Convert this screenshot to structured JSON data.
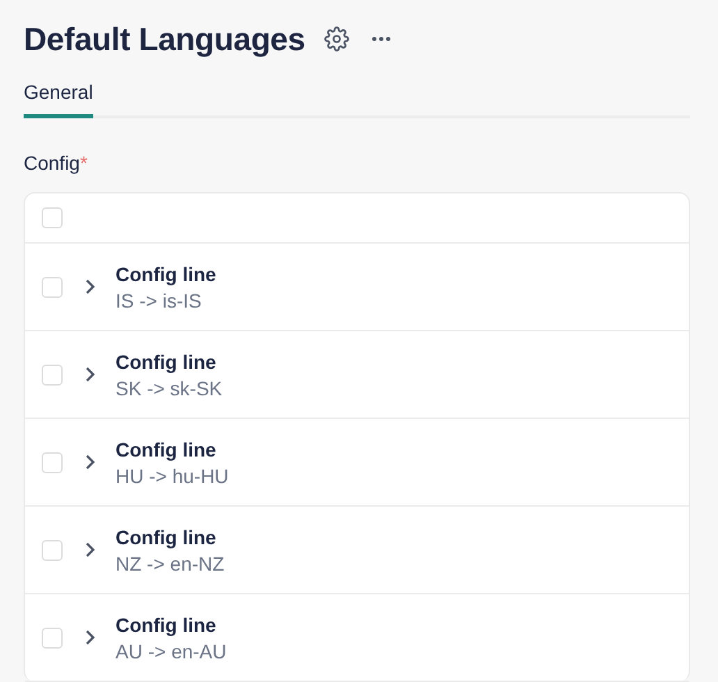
{
  "page": {
    "title": "Default Languages"
  },
  "tabs": [
    {
      "label": "General",
      "selected": true
    }
  ],
  "field": {
    "label": "Config",
    "required_mark": "*"
  },
  "list": {
    "header": {
      "checked": false
    },
    "rows": [
      {
        "title": "Config line",
        "subtitle": "IS -> is-IS",
        "checked": false,
        "expanded": false
      },
      {
        "title": "Config line",
        "subtitle": "SK -> sk-SK",
        "checked": false,
        "expanded": false
      },
      {
        "title": "Config line",
        "subtitle": "HU -> hu-HU",
        "checked": false,
        "expanded": false
      },
      {
        "title": "Config line",
        "subtitle": "NZ -> en-NZ",
        "checked": false,
        "expanded": false
      },
      {
        "title": "Config line",
        "subtitle": "AU -> en-AU",
        "checked": false,
        "expanded": false
      }
    ]
  }
}
